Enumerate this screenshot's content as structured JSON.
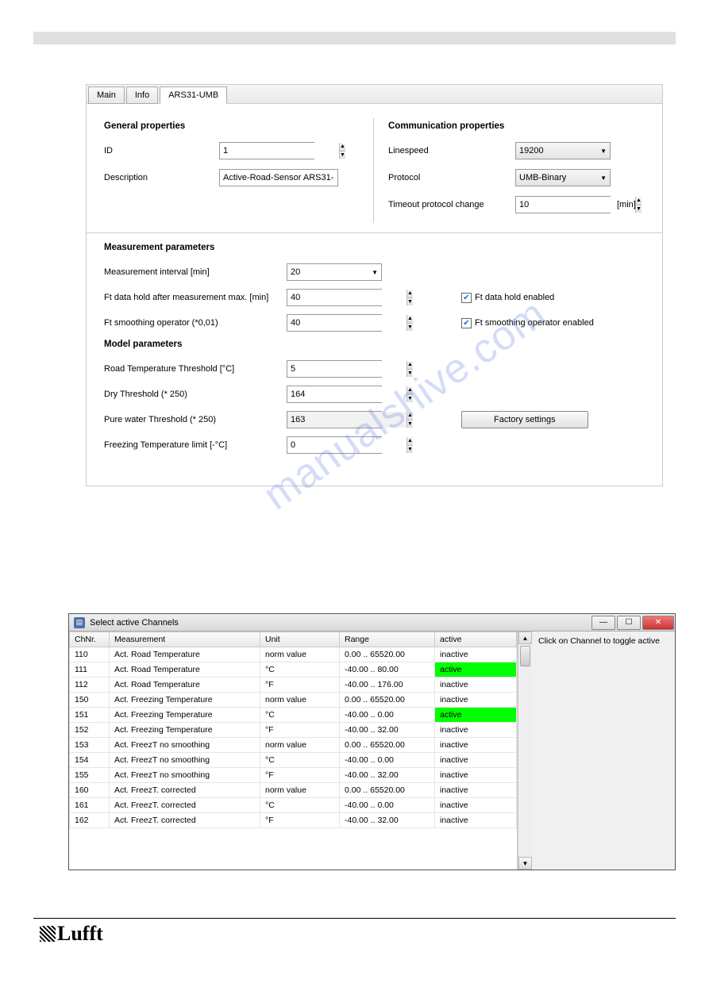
{
  "watermark_text": "manualshive.com",
  "tabs": {
    "main": "Main",
    "info": "Info",
    "ars": "ARS31-UMB"
  },
  "general": {
    "title": "General properties",
    "id_label": "ID",
    "id_value": "1",
    "desc_label": "Description",
    "desc_value": "Active-Road-Sensor ARS31-"
  },
  "comm": {
    "title": "Communication properties",
    "linespeed_label": "Linespeed",
    "linespeed_value": "19200",
    "protocol_label": "Protocol",
    "protocol_value": "UMB-Binary",
    "timeout_label": "Timeout protocol change",
    "timeout_value": "10",
    "timeout_unit": "[min]"
  },
  "meas": {
    "title": "Measurement parameters",
    "interval_label": "Measurement interval [min]",
    "interval_value": "20",
    "hold_label": "Ft data hold after measurement max. [min]",
    "hold_value": "40",
    "smooth_label": "Ft smoothing operator (*0,01)",
    "smooth_value": "40",
    "hold_chk_label": "Ft data hold enabled",
    "smooth_chk_label": "Ft smoothing operator enabled"
  },
  "model": {
    "title": "Model parameters",
    "road_thr_label": "Road Temperature Threshold [°C]",
    "road_thr_value": "5",
    "dry_thr_label": "Dry Threshold (* 250)",
    "dry_thr_value": "164",
    "pure_thr_label": "Pure water Threshold (* 250)",
    "pure_thr_value": "163",
    "freeze_lim_label": "Freezing Temperature limit [-°C]",
    "freeze_lim_value": "0",
    "factory_btn": "Factory settings"
  },
  "channels_window": {
    "title": "Select active Channels",
    "side_hint": "Click on Channel to toggle active",
    "headers": {
      "ch": "ChNr.",
      "meas": "Measurement",
      "unit": "Unit",
      "range": "Range",
      "active": "active"
    },
    "rows": [
      {
        "ch": "110",
        "meas": "Act. Road Temperature",
        "unit": "norm value",
        "range": "0.00 .. 65520.00",
        "active": "inactive"
      },
      {
        "ch": "111",
        "meas": "Act. Road Temperature",
        "unit": "°C",
        "range": "-40.00 .. 80.00",
        "active": "active"
      },
      {
        "ch": "112",
        "meas": "Act. Road Temperature",
        "unit": "°F",
        "range": "-40.00 .. 176.00",
        "active": "inactive"
      },
      {
        "ch": "150",
        "meas": "Act. Freezing Temperature",
        "unit": "norm value",
        "range": "0.00 .. 65520.00",
        "active": "inactive"
      },
      {
        "ch": "151",
        "meas": "Act. Freezing Temperature",
        "unit": "°C",
        "range": "-40.00 .. 0.00",
        "active": "active"
      },
      {
        "ch": "152",
        "meas": "Act. Freezing Temperature",
        "unit": "°F",
        "range": "-40.00 .. 32.00",
        "active": "inactive"
      },
      {
        "ch": "153",
        "meas": "Act. FreezT no smoothing",
        "unit": "norm value",
        "range": "0.00 .. 65520.00",
        "active": "inactive"
      },
      {
        "ch": "154",
        "meas": "Act. FreezT no smoothing",
        "unit": "°C",
        "range": "-40.00 .. 0.00",
        "active": "inactive"
      },
      {
        "ch": "155",
        "meas": "Act. FreezT no smoothing",
        "unit": "°F",
        "range": "-40.00 .. 32.00",
        "active": "inactive"
      },
      {
        "ch": "160",
        "meas": "Act. FreezT. corrected",
        "unit": "norm value",
        "range": "0.00 .. 65520.00",
        "active": "inactive"
      },
      {
        "ch": "161",
        "meas": "Act. FreezT. corrected",
        "unit": "°C",
        "range": "-40.00 .. 0.00",
        "active": "inactive"
      },
      {
        "ch": "162",
        "meas": "Act. FreezT. corrected",
        "unit": "°F",
        "range": "-40.00 .. 32.00",
        "active": "inactive"
      }
    ]
  },
  "logo_text": "Lufft"
}
